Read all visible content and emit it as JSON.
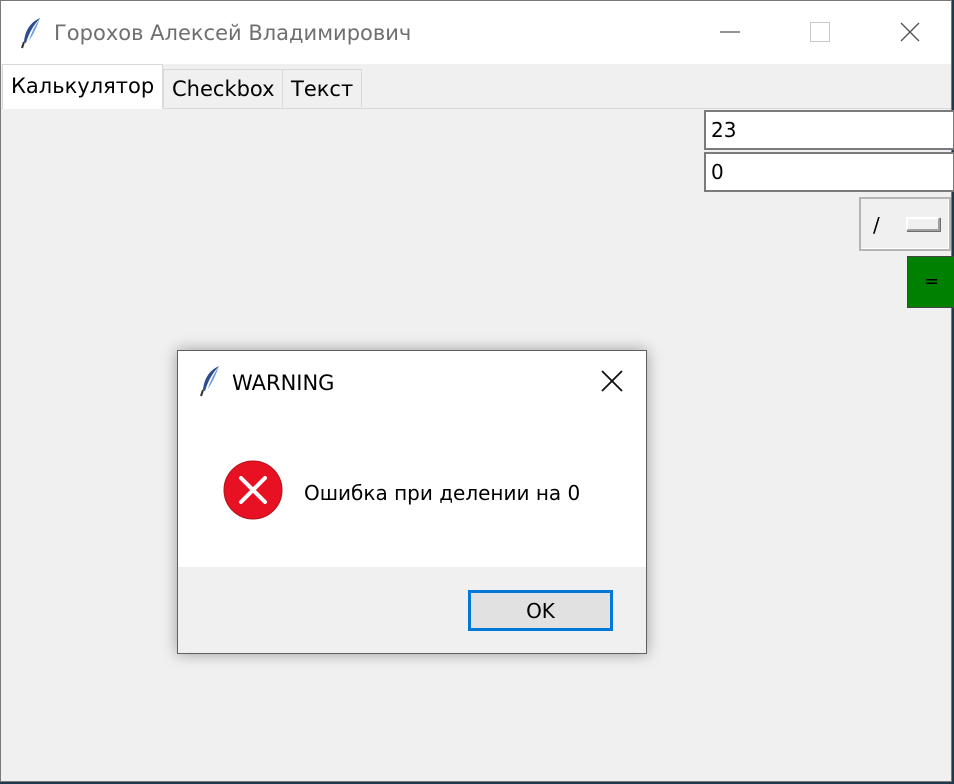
{
  "window": {
    "title": "Горохов Алексей Владимирович",
    "icon": "feather-icon",
    "controls": [
      "minimize-icon",
      "maximize-icon",
      "close-icon"
    ]
  },
  "tabs": [
    {
      "label": "Калькулятор",
      "active": true
    },
    {
      "label": "Checkbox",
      "active": false
    },
    {
      "label": "Текст",
      "active": false
    }
  ],
  "calculator": {
    "operand1": "23",
    "operand2": "0",
    "operation": "/",
    "equals_label": "=",
    "equals_color": "#008000"
  },
  "dialog": {
    "title": "WARNING",
    "icon": "feather-icon",
    "message_icon": "error-icon",
    "message": "Ошибка при делении на 0",
    "ok_label": "OK",
    "accent": "#0078d7",
    "error_color": "#e81123"
  }
}
